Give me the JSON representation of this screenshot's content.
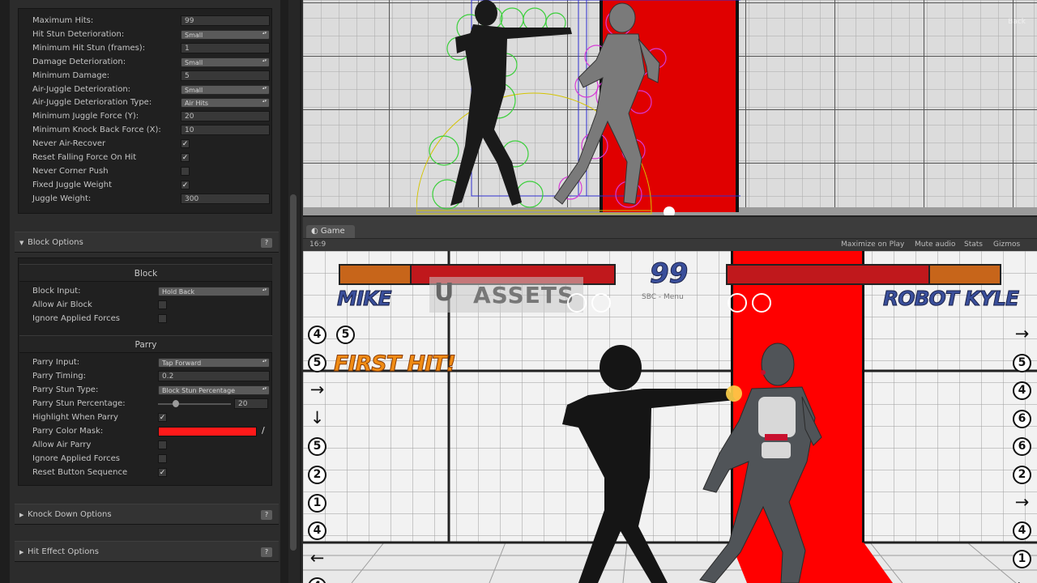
{
  "inspector": {
    "hit_rows": [
      {
        "label": "Maximum Hits:",
        "kind": "field",
        "value": "99"
      },
      {
        "label": "Hit Stun Deterioration:",
        "kind": "drop",
        "value": "Small"
      },
      {
        "label": "Minimum Hit Stun (frames):",
        "kind": "field",
        "value": "1"
      },
      {
        "label": "Damage Deterioration:",
        "kind": "drop",
        "value": "Small"
      },
      {
        "label": "Minimum Damage:",
        "kind": "field",
        "value": "5"
      },
      {
        "label": "Air-Juggle Deterioration:",
        "kind": "drop",
        "value": "Small"
      },
      {
        "label": "Air-Juggle Deterioration Type:",
        "kind": "drop",
        "value": "Air Hits"
      },
      {
        "label": "Minimum Juggle Force (Y):",
        "kind": "field",
        "value": "20"
      },
      {
        "label": "Minimum Knock Back Force (X):",
        "kind": "field",
        "value": "10"
      },
      {
        "label": "Never Air-Recover",
        "kind": "chk",
        "value": "✓"
      },
      {
        "label": "Reset Falling Force On Hit",
        "kind": "chk",
        "value": "✓"
      },
      {
        "label": "Never Corner Push",
        "kind": "chk",
        "value": ""
      },
      {
        "label": "Fixed Juggle Weight",
        "kind": "chk",
        "value": "✓"
      },
      {
        "label": "Juggle Weight:",
        "kind": "field",
        "value": "300"
      }
    ],
    "block_section": "Block Options",
    "block_title": "Block",
    "block_rows": [
      {
        "label": "Block Input:",
        "kind": "drop",
        "value": "Hold Back"
      },
      {
        "label": "Allow Air Block",
        "kind": "chk",
        "value": ""
      },
      {
        "label": "Ignore Applied Forces",
        "kind": "chk",
        "value": ""
      }
    ],
    "parry_title": "Parry",
    "parry_rows": [
      {
        "label": "Parry Input:",
        "kind": "drop",
        "value": "Tap Forward"
      },
      {
        "label": "Parry Timing:",
        "kind": "field",
        "value": "0.2"
      },
      {
        "label": "Parry Stun Type:",
        "kind": "drop",
        "value": "Block Stun Percentage"
      },
      {
        "label": "Parry Stun Percentage:",
        "kind": "slider",
        "value": "20"
      },
      {
        "label": "Highlight When Parry",
        "kind": "chk",
        "value": "✓"
      },
      {
        "label": "Parry Color Mask:",
        "kind": "color",
        "value": ""
      },
      {
        "label": "Allow Air Parry",
        "kind": "chk",
        "value": ""
      },
      {
        "label": "Ignore Applied Forces",
        "kind": "chk",
        "value": ""
      },
      {
        "label": "Reset Button Sequence",
        "kind": "chk",
        "value": "✓"
      }
    ],
    "parry_stun_fraction": 0.2,
    "parry_color": "#ff1a1a",
    "knockdown_section": "Knock Down Options",
    "hiteffect_section": "Hit Effect Options",
    "help_label": "?"
  },
  "scene": {
    "back_label": "Back"
  },
  "game_window": {
    "tab_label": "Game",
    "aspect": "16:9",
    "toolbar": [
      "Maximize on Play",
      "Mute audio",
      "Stats",
      "Gizmos"
    ]
  },
  "hud": {
    "player1": "MIKE",
    "player2": "ROBOT KYLE",
    "timer": "99",
    "timer_sub": "SBC - Menu",
    "watermark": "ASSETS",
    "watermark_logo": "U",
    "first_hit": "FIRST HIT!",
    "p1_health": 1.0,
    "p2_health": 1.0,
    "health_color": "#c0181c",
    "portrait_color": "#c7651a",
    "left_inputs": [
      "4",
      "5",
      "→",
      "↓",
      "5",
      "2",
      "1",
      "4",
      "←",
      "4"
    ],
    "right_inputs": [
      "→",
      "5",
      "4",
      "6",
      "6",
      "2",
      "→",
      "4",
      "1",
      "←"
    ]
  }
}
